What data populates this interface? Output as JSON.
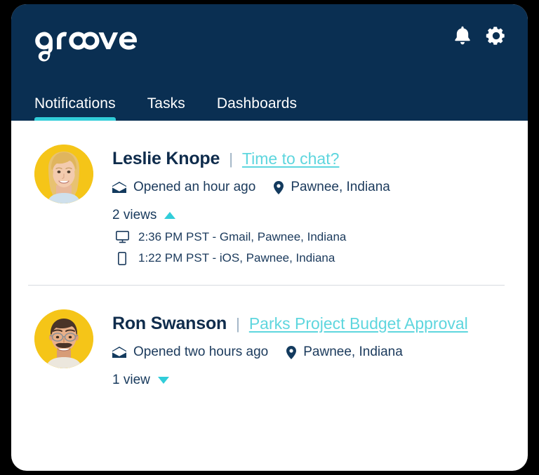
{
  "app": {
    "logo_text": "groove",
    "header_bg": "#0a2f52",
    "accent_teal": "#31cdd9",
    "link_teal": "#5ed6de",
    "avatar_bg": "#f5c518"
  },
  "header": {
    "icons": [
      {
        "name": "bell-icon",
        "label": "Notifications bell"
      },
      {
        "name": "gear-icon",
        "label": "Settings"
      }
    ],
    "tabs": [
      {
        "label": "Notifications",
        "active": true
      },
      {
        "label": "Tasks",
        "active": false
      },
      {
        "label": "Dashboards",
        "active": false
      }
    ]
  },
  "notifications": [
    {
      "name": "Leslie Knope",
      "separator": "|",
      "subject": "Time to chat?",
      "opened": "Opened an hour ago",
      "location": "Pawnee, Indiana",
      "views_label": "2 views",
      "expanded": true,
      "views": [
        {
          "device": "desktop",
          "text": "2:36 PM PST - Gmail, Pawnee, Indiana"
        },
        {
          "device": "mobile",
          "text": "1:22 PM PST - iOS, Pawnee, Indiana"
        }
      ]
    },
    {
      "name": "Ron Swanson",
      "separator": "|",
      "subject": "Parks Project Budget Approval",
      "opened": "Opened two hours ago",
      "location": "Pawnee, Indiana",
      "views_label": "1 view",
      "expanded": false,
      "views": []
    }
  ]
}
